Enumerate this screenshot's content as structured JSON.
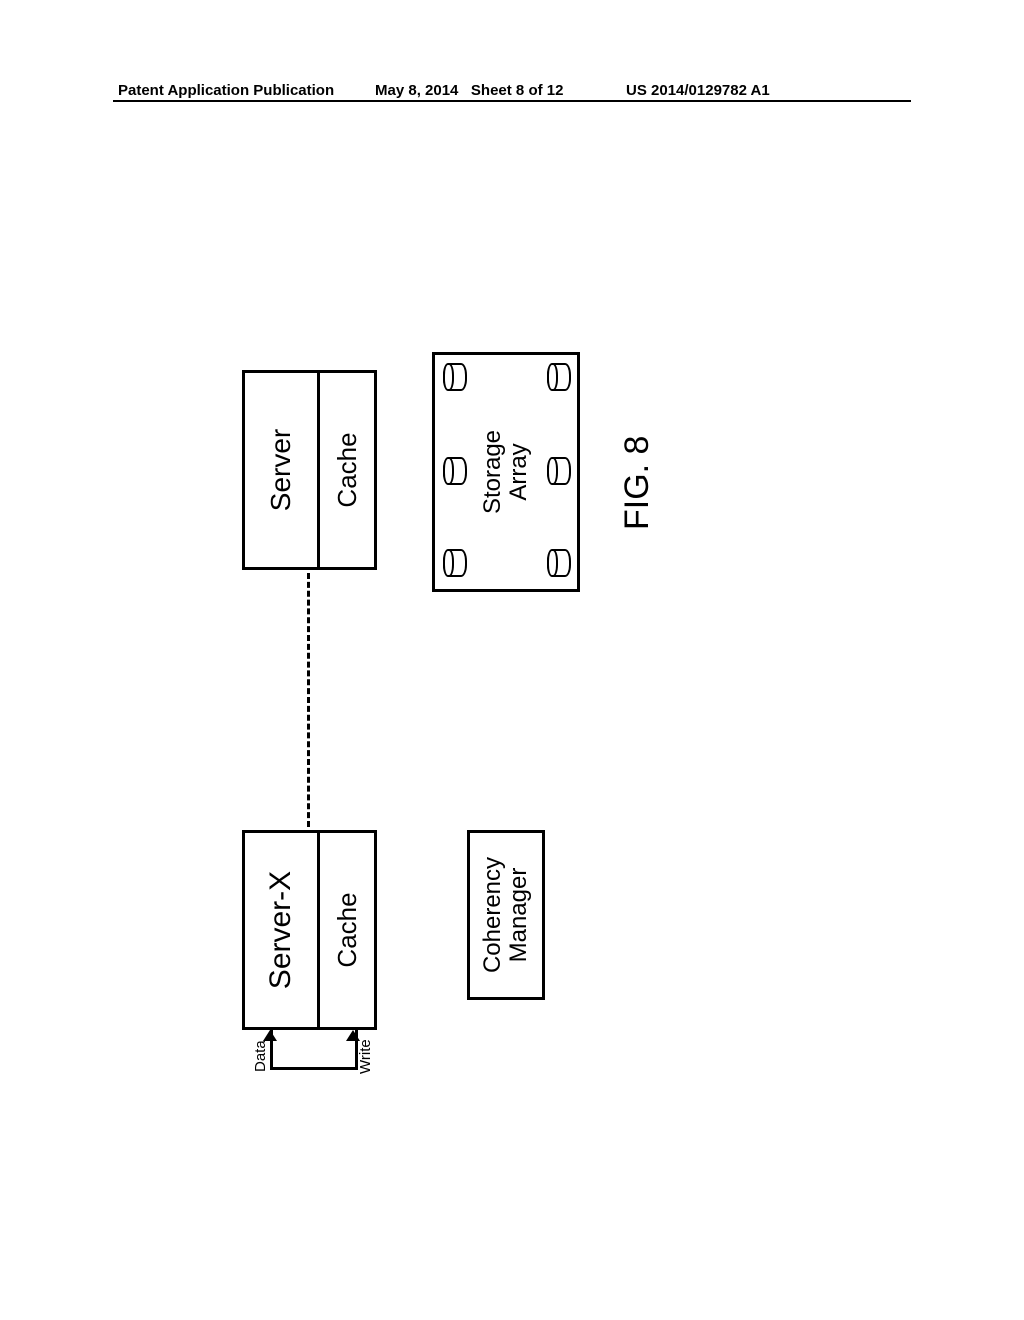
{
  "header": {
    "publication": "Patent Application Publication",
    "date": "May 8, 2014",
    "sheet_label": "Sheet 8 of 12",
    "pubno": "US 2014/0129782 A1"
  },
  "figure": {
    "servers": {
      "left_server": "Server-X",
      "left_cache": "Cache",
      "right_server": "Server",
      "right_cache": "Cache"
    },
    "coherency_manager": "Coherency\nManager",
    "storage_array": "Storage\nArray",
    "arrows": {
      "data_label": "Data",
      "write_label": "Write"
    },
    "fig_label": "FIG. 8"
  }
}
